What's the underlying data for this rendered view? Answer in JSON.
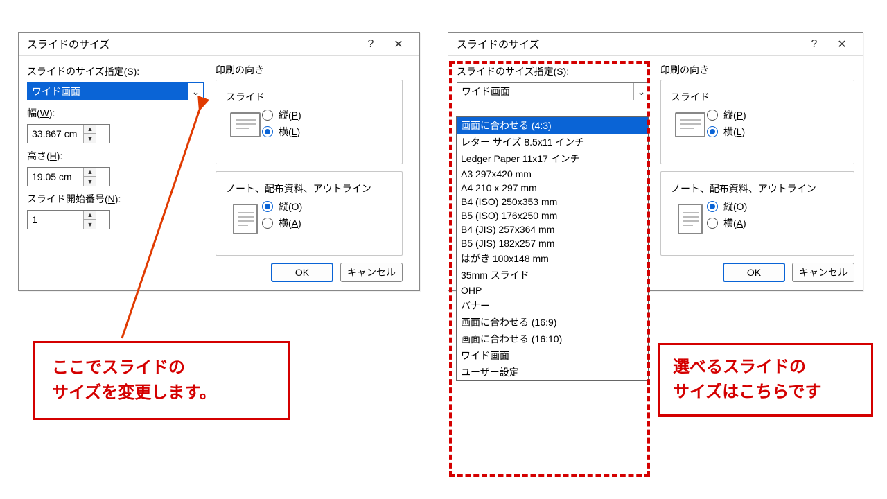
{
  "dialog": {
    "title": "スライドのサイズ",
    "help": "?",
    "close": "✕",
    "size_label_pre": "スライドのサイズ指定(",
    "size_label_u": "S",
    "size_label_post": "):",
    "size_value": "ワイド画面",
    "width_label_pre": "幅(",
    "width_label_u": "W",
    "width_label_post": "):",
    "width_value": "33.867 cm",
    "height_label_pre": "高さ(",
    "height_label_u": "H",
    "height_label_post": "):",
    "height_value": "19.05 cm",
    "startnum_label_pre": "スライド開始番号(",
    "startnum_label_u": "N",
    "startnum_label_post": "):",
    "startnum_value": "1",
    "orient_title": "印刷の向き",
    "slide_title": "スライド",
    "notes_title": "ノート、配布資料、アウトライン",
    "vert_pre": "縦(",
    "vert_u_P": "P",
    "vert_u_O": "O",
    "vert_post": ")",
    "horiz_pre": "横(",
    "horiz_u_L": "L",
    "horiz_u_A": "A",
    "horiz_post": ")",
    "ok": "OK",
    "cancel": "キャンセル"
  },
  "dropdown": {
    "current": "ワイド画面",
    "selected": "画面に合わせる (4:3)",
    "items": [
      "画面に合わせる (4:3)",
      "レター サイズ 8.5x11 インチ",
      "Ledger Paper 11x17 インチ",
      "A3 297x420 mm",
      "A4 210 x 297 mm",
      "B4 (ISO) 250x353 mm",
      "B5 (ISO) 176x250 mm",
      "B4 (JIS) 257x364 mm",
      "B5 (JIS) 182x257 mm",
      "はがき 100x148 mm",
      "35mm スライド",
      "OHP",
      "バナー",
      "画面に合わせる (16:9)",
      "画面に合わせる (16:10)",
      "ワイド画面",
      "ユーザー設定"
    ]
  },
  "callouts": {
    "left_l1": "ここでスライドの",
    "left_l2": "サイズを変更します。",
    "right_l1": "選べるスライドの",
    "right_l2": "サイズはこちらです"
  }
}
